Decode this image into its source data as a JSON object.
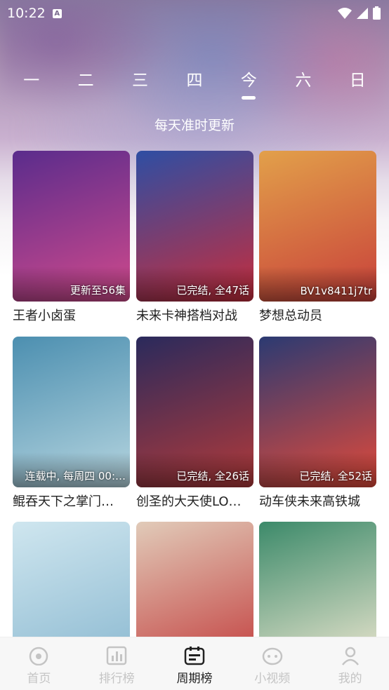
{
  "status_bar": {
    "time": "10:22",
    "a_badge": "A"
  },
  "weekdays": [
    {
      "label": "一",
      "active": false
    },
    {
      "label": "二",
      "active": false
    },
    {
      "label": "三",
      "active": false
    },
    {
      "label": "四",
      "active": false
    },
    {
      "label": "今",
      "active": true
    },
    {
      "label": "六",
      "active": false
    },
    {
      "label": "日",
      "active": false
    }
  ],
  "subtitle": "每天准时更新",
  "cards": [
    {
      "title": "王者小卤蛋",
      "badge": "更新至56集",
      "colors": [
        "#5a2c8c",
        "#d14a8c"
      ]
    },
    {
      "title": "未来卡神搭档对战",
      "badge": "已完结, 全47话",
      "colors": [
        "#2e4ea3",
        "#c72d3c"
      ]
    },
    {
      "title": "梦想总动员",
      "badge": "BV1v8411j7tr",
      "colors": [
        "#e2a04a",
        "#c8403a"
      ]
    },
    {
      "title": "鲲吞天下之掌门…",
      "badge": "连载中, 每周四 00:…",
      "colors": [
        "#4c8fb0",
        "#b7d6e0"
      ]
    },
    {
      "title": "创圣的大天使LO…",
      "badge": "已完结, 全26话",
      "colors": [
        "#2a2a5c",
        "#b23a3a"
      ]
    },
    {
      "title": "动车侠未来高铁城",
      "badge": "已完结, 全52话",
      "colors": [
        "#2b3a72",
        "#e24a3a"
      ]
    },
    {
      "title": "",
      "badge": "",
      "colors": [
        "#cfe6ef",
        "#8ab8d0"
      ]
    },
    {
      "title": "",
      "badge": "",
      "colors": [
        "#e1cbb9",
        "#c23b3b"
      ]
    },
    {
      "title": "",
      "badge": "",
      "colors": [
        "#3c8a6a",
        "#f2e9d3"
      ]
    }
  ],
  "nav": [
    {
      "label": "首页",
      "icon": "home-icon",
      "active": false
    },
    {
      "label": "排行榜",
      "icon": "ranking-icon",
      "active": false
    },
    {
      "label": "周期榜",
      "icon": "calendar-icon",
      "active": true
    },
    {
      "label": "小视频",
      "icon": "short-video-icon",
      "active": false
    },
    {
      "label": "我的",
      "icon": "profile-icon",
      "active": false
    }
  ]
}
